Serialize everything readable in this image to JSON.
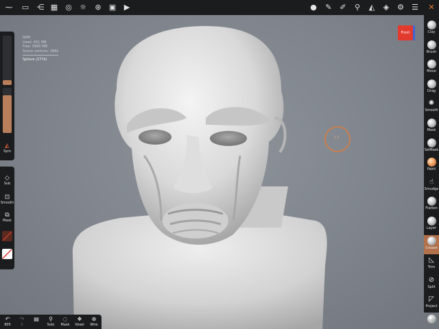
{
  "top_toolbar": {
    "left_icons": [
      {
        "name": "nomad-logo-icon",
        "glyph": "⁓"
      },
      {
        "name": "folder-icon",
        "glyph": "▭"
      },
      {
        "name": "scene-tree-icon",
        "glyph": "⋲"
      },
      {
        "name": "grid-icon",
        "glyph": "▦"
      },
      {
        "name": "topology-icon",
        "glyph": "◎"
      },
      {
        "name": "light-icon",
        "glyph": "☼"
      },
      {
        "name": "material-icon",
        "glyph": "⊛"
      },
      {
        "name": "background-image-icon",
        "glyph": "▣"
      },
      {
        "name": "camera-icon",
        "glyph": "▶"
      }
    ],
    "right_icons": [
      {
        "name": "matcap-icon",
        "glyph": "●"
      },
      {
        "name": "pencil-icon",
        "glyph": "✎"
      },
      {
        "name": "stroke-icon",
        "glyph": "✐"
      },
      {
        "name": "symmetry-icon",
        "glyph": "⚲"
      },
      {
        "name": "shading-icon",
        "glyph": "◭"
      },
      {
        "name": "layers-icon",
        "glyph": "◈"
      },
      {
        "name": "settings-icon",
        "glyph": "⚙"
      },
      {
        "name": "menu-sliders-icon",
        "glyph": "☰"
      },
      {
        "name": "tools-icon",
        "glyph": "✕"
      }
    ]
  },
  "stats": {
    "lines": [
      "RAM",
      "Used: 451 MB",
      "Free: 5800 MB",
      "Scene vertices: 286k"
    ],
    "object": "Sphere (277k)"
  },
  "view_cube_label": "Front",
  "cursor_value": "1.5",
  "left_sliders": {
    "radius": 0.1,
    "intensity": 0.83
  },
  "left_top_tools": [
    {
      "name": "sym-tool",
      "icon": "symmetry-icon",
      "glyph": "◭",
      "label": "Sym"
    }
  ],
  "left_bottom_tools": [
    {
      "name": "sub-tool",
      "icon": "drop-icon",
      "glyph": "◇",
      "label": "Sub"
    },
    {
      "name": "smooth-tool",
      "icon": "smooth-square-icon",
      "glyph": "⊡",
      "label": "Smooth"
    },
    {
      "name": "mask-tool",
      "icon": "mask-square-icon",
      "glyph": "⧉",
      "label": "Mask"
    }
  ],
  "swatch_colors": {
    "material": "#5a2a20",
    "paint": "#ffffff"
  },
  "right_tools": [
    {
      "label": "Clay",
      "type": "ball"
    },
    {
      "label": "Brush",
      "type": "ball"
    },
    {
      "label": "Move",
      "type": "ball"
    },
    {
      "label": "Drag",
      "type": "ball"
    },
    {
      "label": "Smooth",
      "type": "glyph",
      "glyph": "✺"
    },
    {
      "label": "Mask",
      "type": "ball"
    },
    {
      "label": "SelMask",
      "type": "ball"
    },
    {
      "label": "Paint",
      "type": "ball-orange"
    },
    {
      "label": "Smudge",
      "type": "glyph",
      "glyph": "☝"
    },
    {
      "label": "Flatten",
      "type": "ball"
    },
    {
      "label": "Layer",
      "type": "ball"
    },
    {
      "label": "Crease",
      "type": "ball",
      "active": true
    },
    {
      "label": "Trim",
      "type": "glyph",
      "glyph": "◺"
    },
    {
      "label": "Split",
      "type": "glyph",
      "glyph": "⊘"
    },
    {
      "label": "Project",
      "type": "glyph",
      "glyph": "◸"
    },
    {
      "label": "",
      "type": "ball"
    }
  ],
  "right_footer": "1.60",
  "bottom_tools": [
    {
      "name": "undo-button",
      "icon": "undo-icon",
      "glyph": "↶",
      "label": "905",
      "dim": false
    },
    {
      "name": "redo-button",
      "icon": "redo-icon",
      "glyph": "↷",
      "label": "0",
      "dim": true
    },
    {
      "name": "gizmo-button",
      "icon": "box-icon",
      "glyph": "▤",
      "label": "",
      "dim": false
    },
    {
      "name": "solo-button",
      "icon": "magnifier-icon",
      "glyph": "⚲",
      "label": "Solo",
      "dim": false
    },
    {
      "name": "mask-visibility-button",
      "icon": "eye-slash-icon",
      "glyph": "◌",
      "label": "Mask",
      "dim": false
    },
    {
      "name": "voxel-button",
      "icon": "voxel-icon",
      "glyph": "❖",
      "label": "Voxel",
      "dim": false
    },
    {
      "name": "wire-button",
      "icon": "wire-icon",
      "glyph": "⊕",
      "label": "Wire",
      "dim": false
    }
  ]
}
